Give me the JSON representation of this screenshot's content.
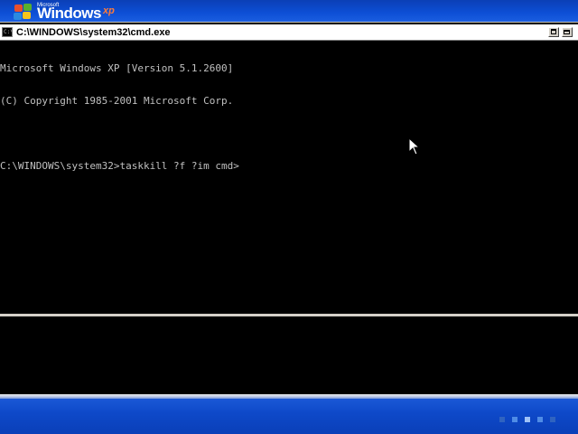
{
  "boot_banner": {
    "logo_microsoft": "Microsoft",
    "logo_windows": "Windows",
    "logo_xp": "xp"
  },
  "window": {
    "icon_text": "C:\\",
    "title": "C:\\WINDOWS\\system32\\cmd.exe"
  },
  "console": {
    "lines": [
      "Microsoft Windows XP [Version 5.1.2600]",
      "(C) Copyright 1985-2001 Microsoft Corp.",
      "",
      "C:\\WINDOWS\\system32>taskkill ?f ?im cmd>"
    ],
    "text_color": "#c0c0c0",
    "background_color": "#000000"
  },
  "icons": {
    "window_icon": "console-window-icon",
    "restore": "restore-icon",
    "close": "close-icon",
    "cursor": "mouse-pointer-icon"
  },
  "colors": {
    "xp_blue": "#0d4fd6",
    "title_bar": "#ffffff"
  }
}
